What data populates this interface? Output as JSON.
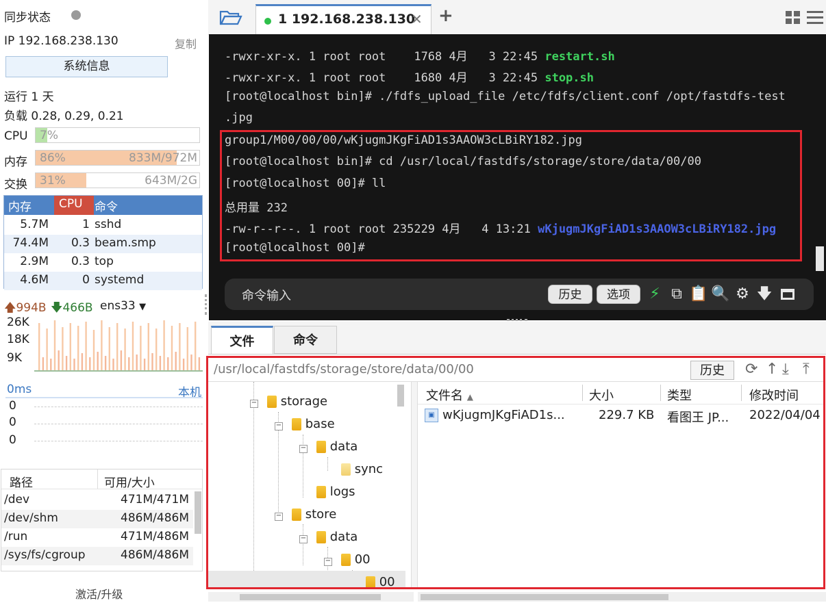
{
  "sidebar": {
    "sync_status": "同步状态",
    "ip_label": "IP 192.168.238.130",
    "copy": "复制",
    "sysinfo_button": "系统信息",
    "uptime": "运行 1 天",
    "load": "负载 0.28, 0.29, 0.21",
    "cpu": {
      "label": "CPU",
      "pct": "7%",
      "fraction": 0.07
    },
    "mem": {
      "label": "内存",
      "pct": "86%",
      "value": "833M/972M",
      "fraction": 0.86
    },
    "swap": {
      "label": "交换",
      "pct": "31%",
      "value": "643M/2G",
      "fraction": 0.31
    },
    "proc_headers": [
      "内存",
      "CPU",
      "命令"
    ],
    "procs": [
      {
        "mem": "5.7M",
        "cpu": "1",
        "cmd": "sshd"
      },
      {
        "mem": "74.4M",
        "cpu": "0.3",
        "cmd": "beam.smp"
      },
      {
        "mem": "2.9M",
        "cpu": "0.3",
        "cmd": "top"
      },
      {
        "mem": "4.6M",
        "cpu": "0",
        "cmd": "systemd"
      }
    ],
    "net": {
      "up": "994B",
      "down": "466B",
      "iface": "ens33",
      "ticks": [
        "26K",
        "18K",
        "9K"
      ]
    },
    "latency": {
      "label": "0ms",
      "host": "本机",
      "values": [
        "0",
        "0",
        "0"
      ]
    },
    "disk_headers": [
      "路径",
      "可用/大小"
    ],
    "disks": [
      {
        "path": "/dev",
        "size": "471M/471M"
      },
      {
        "path": "/dev/shm",
        "size": "486M/486M"
      },
      {
        "path": "/run",
        "size": "471M/486M"
      },
      {
        "path": "/sys/fs/cgroup",
        "size": "486M/486M"
      }
    ],
    "activate": "激活/升级"
  },
  "tabs": {
    "active_tab": "1 192.168.238.130",
    "add": "+"
  },
  "terminal": {
    "lines": [
      {
        "pre": "-rwxr-xr-x. 1 root root    1768 4月   3 22:45 ",
        "name": "restart.sh",
        "cls": "green"
      },
      {
        "pre": "-rwxr-xr-x. 1 root root    1680 4月   3 22:45 ",
        "name": "stop.sh",
        "cls": "green"
      },
      {
        "pre": "[root@localhost bin]# ./fdfs_upload_file /etc/fdfs/client.conf /opt/fastdfs-test",
        "name": "",
        "cls": ""
      },
      {
        "pre": ".jpg",
        "name": "",
        "cls": ""
      },
      {
        "pre": "group1/M00/00/00/wKjugmJKgFiAD1s3AAOW3cLBiRY182.jpg",
        "name": "",
        "cls": ""
      },
      {
        "pre": "[root@localhost bin]# cd /usr/local/fastdfs/storage/store/data/00/00",
        "name": "",
        "cls": ""
      },
      {
        "pre": "[root@localhost 00]# ll",
        "name": "",
        "cls": ""
      },
      {
        "pre": "总用量 232",
        "name": "",
        "cls": ""
      },
      {
        "pre": "-rw-r--r--. 1 root root 235229 4月   4 13:21 ",
        "name": "wKjugmJKgFiAD1s3AAOW3cLBiRY182.jpg",
        "cls": "blue"
      },
      {
        "pre": "[root@localhost 00]#",
        "name": "",
        "cls": ""
      }
    ],
    "cmd_placeholder": "命令输入",
    "history_btn": "历史",
    "options_btn": "选项"
  },
  "panel": {
    "tab_files": "文件",
    "tab_commands": "命令",
    "path": "/usr/local/fastdfs/storage/store/data/00/00",
    "history_btn": "历史",
    "tree": [
      "storage",
      "base",
      "data",
      "sync",
      "logs",
      "store",
      "data",
      "00",
      "00"
    ],
    "columns": [
      "文件名",
      "大小",
      "类型",
      "修改时间"
    ],
    "files": [
      {
        "name": "wKjugmJKgFiAD1s...",
        "size": "229.7 KB",
        "type": "看图王 JP...",
        "mtime": "2022/04/04"
      }
    ]
  },
  "colors": {
    "accent_blue": "#4f83c5",
    "cpu_red": "#cf4e3e",
    "highlight_red": "#e0262f",
    "terminal_bg": "#151515"
  }
}
